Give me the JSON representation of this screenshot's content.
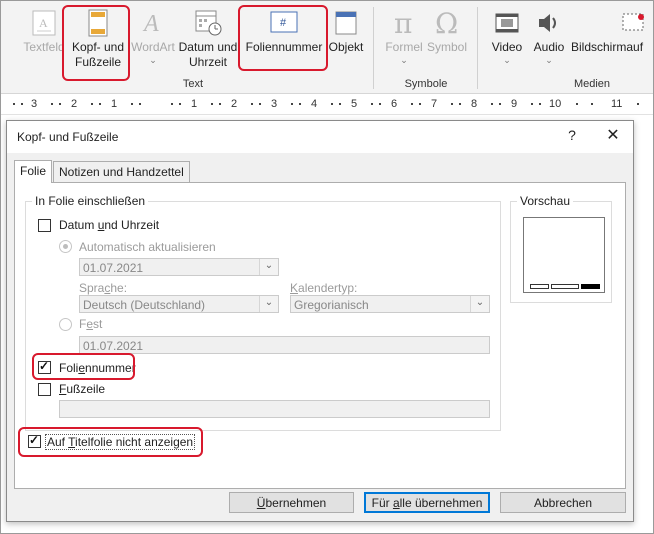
{
  "ribbon": {
    "items": [
      {
        "label": "Textfeld"
      },
      {
        "line1": "Kopf- und",
        "line2": "Fußzeile"
      },
      {
        "label": "WordArt",
        "chevron": "⌄"
      },
      {
        "line1": "Datum und",
        "line2": "Uhrzeit"
      },
      {
        "label": "Foliennummer"
      },
      {
        "label": "Objekt"
      },
      {
        "label": "Formel",
        "chevron": "⌄"
      },
      {
        "label": "Symbol"
      },
      {
        "label": "Video",
        "chevron": "⌄"
      },
      {
        "label": "Audio",
        "chevron": "⌄"
      },
      {
        "label": "Bildschirmauf"
      }
    ],
    "groups": {
      "text": "Text",
      "symbole": "Symbole",
      "medien": "Medien"
    }
  },
  "ruler": {
    "labels": [
      "3",
      "2",
      "1",
      "",
      "1",
      "2",
      "3",
      "4",
      "5",
      "6",
      "7",
      "8",
      "9",
      "10",
      "11"
    ]
  },
  "dialog": {
    "title": "Kopf- und Fußzeile",
    "help": "?",
    "close": "✕",
    "tabs": [
      "Folie",
      "Notizen und Handzettel"
    ],
    "section_title": "In Folie einschließen",
    "datum_pre": "Datum ",
    "datum_u": "u",
    "datum_post": "nd Uhrzeit",
    "auto_label": "Automatisch aktualisieren",
    "auto_date": "01.07.2021",
    "sprache_pre": "Spra",
    "sprache_u": "c",
    "sprache_post": "he:",
    "sprache_value": "Deutsch (Deutschland)",
    "kalender_pre": "",
    "kalender_u": "K",
    "kalender_post": "alendertyp:",
    "kalender_value": "Gregorianisch",
    "fest_pre": "F",
    "fest_u": "e",
    "fest_post": "st",
    "fest_value": "01.07.2021",
    "folie_pre": "Foli",
    "folie_u": "e",
    "folie_post": "nnummer",
    "fuss_pre": "",
    "fuss_u": "F",
    "fuss_post": "ußzeile",
    "titel_pre": "Auf ",
    "titel_u": "T",
    "titel_post": "itelfolie nicht anzeigen",
    "vorschau": "Vorschau",
    "btn_apply_pre": "",
    "btn_apply_u": "Ü",
    "btn_apply_post": "bernehmen",
    "btn_all_pre": "Für ",
    "btn_all_u": "a",
    "btn_all_post": "lle übernehmen",
    "btn_cancel": "Abbrechen"
  },
  "colors": {
    "highlight": "#d8192d",
    "focus": "#0078d7"
  }
}
